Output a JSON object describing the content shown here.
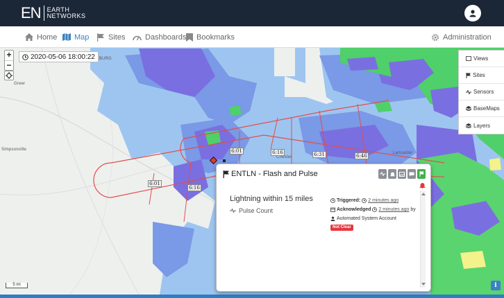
{
  "header": {
    "logo_mark": "EN",
    "logo_line1": "EARTH",
    "logo_line2": "NETWORKS"
  },
  "nav": {
    "home": "Home",
    "map": "Map",
    "sites": "Sites",
    "dashboards": "Dashboards",
    "bookmarks": "Bookmarks",
    "administration": "Administration"
  },
  "map": {
    "timestamp": "2020-05-06 18:00:22",
    "zoom_in": "+",
    "zoom_out": "−",
    "scale": "5 mi",
    "info": "i",
    "cities": {
      "spartanburg": "SPARTANBURG",
      "greer": "Greer",
      "simpsonville": "Simpsonville",
      "chester": "Chester",
      "lancaster": "Lancaster"
    },
    "time_labels": [
      "6:01",
      "6:16",
      "6:01",
      "6:16",
      "6:31",
      "6:46"
    ]
  },
  "side_panel": {
    "items": [
      "Views",
      "Sites",
      "Sensors",
      "BaseMaps",
      "Layers"
    ]
  },
  "popup": {
    "title": "ENTLN - Flash and Pulse",
    "alert_name": "Lightning within 15 miles",
    "pulse_count": "Pulse Count",
    "triggered_label": "Triggered:",
    "triggered_time": "2 minutes ago",
    "acknowledged_label": "Acknowledged",
    "acknowledged_time": "2 minutes ago",
    "acknowledged_by": "by",
    "account": "Automated System Account",
    "status_badge": "Not Clear"
  },
  "colors": {
    "header_bg": "#1b2637",
    "accent": "#3b82c4",
    "alert_red": "#e8363d",
    "ack_green": "#3fb04a"
  }
}
